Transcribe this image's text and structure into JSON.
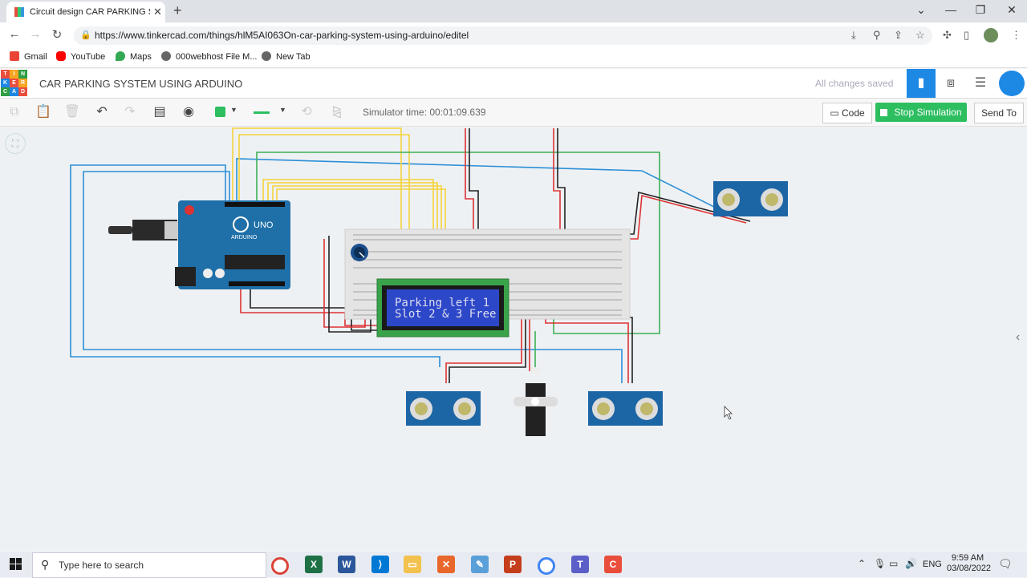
{
  "browser": {
    "tab_title": "Circuit design CAR PARKING SYS",
    "url": "https://www.tinkercad.com/things/hlM5AI063On-car-parking-system-using-arduino/editel",
    "bookmarks": [
      "Gmail",
      "YouTube",
      "Maps",
      "000webhost File M...",
      "New Tab"
    ]
  },
  "app": {
    "project_title": "CAR PARKING SYSTEM USING ARDUINO",
    "save_status": "All changes saved",
    "logo_letters": [
      "T",
      "I",
      "N",
      "K",
      "E",
      "R",
      "C",
      "A",
      "D"
    ],
    "accent": "#1e88e5"
  },
  "toolbar": {
    "simulator_time": "Simulator time: 00:01:09.639",
    "code_label": "Code",
    "stop_label": "Stop Simulation",
    "send_label": "Send To",
    "stop_color": "#2dbe60"
  },
  "circuit": {
    "lcd_line1": "Parking left 1",
    "lcd_line2": "Slot 2 & 3 Free",
    "arduino_label": "UNO",
    "arduino_brand": "ARDUINO"
  },
  "taskbar": {
    "search_placeholder": "Type here to search",
    "language": "ENG",
    "time": "9:59 AM",
    "date": "03/08/2022"
  }
}
